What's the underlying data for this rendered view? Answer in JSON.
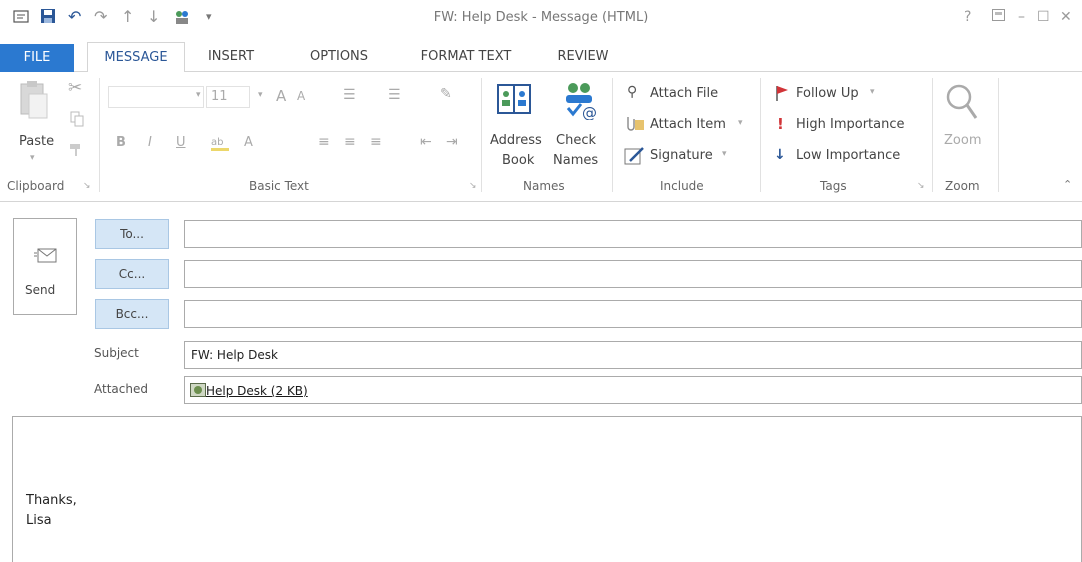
{
  "window": {
    "title": "FW: Help Desk - Message (HTML)",
    "help": "?",
    "minimize": "–",
    "restore": "☐",
    "close": "✕"
  },
  "tabs": [
    "FILE",
    "MESSAGE",
    "INSERT",
    "OPTIONS",
    "FORMAT TEXT",
    "REVIEW"
  ],
  "ribbon": {
    "clipboard": {
      "paste": "Paste",
      "label": "Clipboard"
    },
    "basic_text": {
      "font_size": "11",
      "grow": "A",
      "shrink": "A",
      "bold": "B",
      "italic": "I",
      "underline": "U",
      "font_color": "A",
      "label": "Basic Text"
    },
    "names": {
      "address_book_1": "Address",
      "address_book_2": "Book",
      "check_names_1": "Check",
      "check_names_2": "Names",
      "label": "Names"
    },
    "include": {
      "attach_file": "Attach File",
      "attach_item": "Attach Item",
      "signature": "Signature",
      "label": "Include"
    },
    "tags": {
      "follow_up": "Follow Up",
      "high_importance": "High Importance",
      "low_importance": "Low Importance",
      "label": "Tags"
    },
    "zoom": {
      "button": "Zoom",
      "label": "Zoom"
    }
  },
  "compose": {
    "send": "Send",
    "to": "To...",
    "cc": "Cc...",
    "bcc": "Bcc...",
    "to_value": "",
    "cc_value": "",
    "bcc_value": "",
    "subject_label": "Subject",
    "subject_value": "FW: Help Desk",
    "attached_label": "Attached",
    "attachment": "Help Desk (2 KB)",
    "body_line1": "Thanks,",
    "body_line2": "Lisa"
  },
  "colors": {
    "file_tab": "#2b79d0",
    "address_button": "#d5e6f6",
    "follow_up_flag": "#d13438",
    "high_importance": "#d13438",
    "low_importance": "#2b5797"
  }
}
